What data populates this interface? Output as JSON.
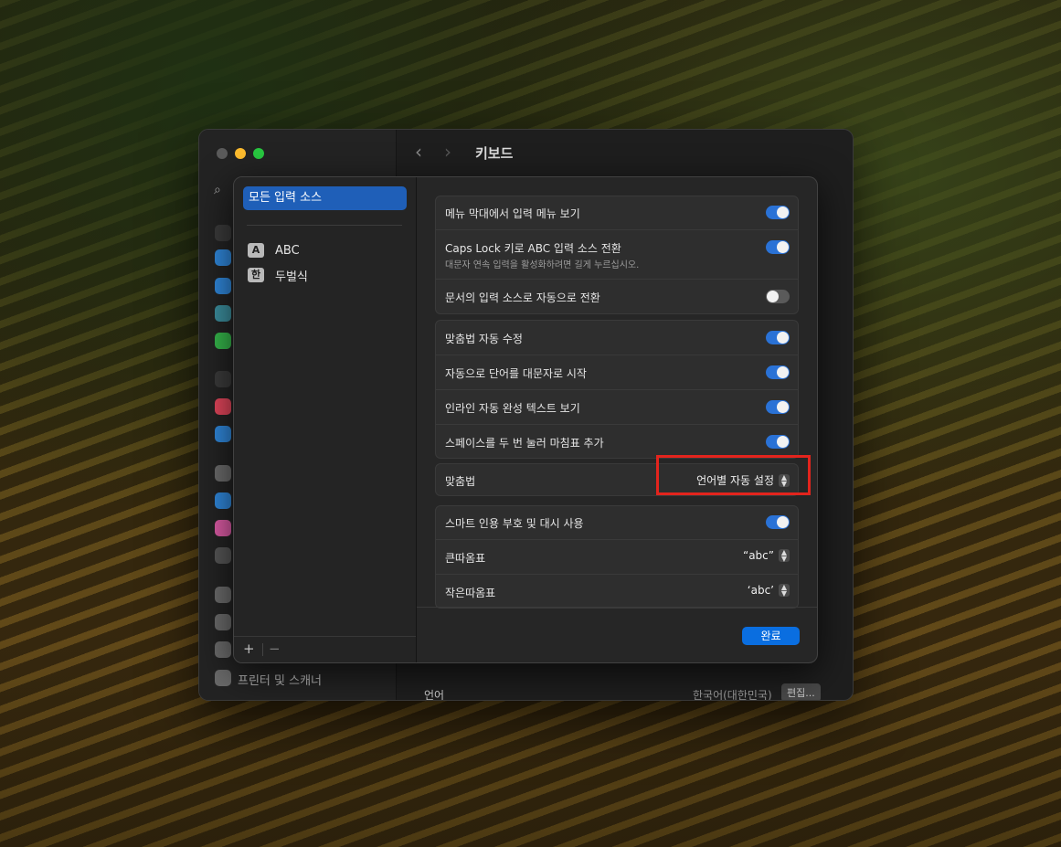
{
  "window": {
    "title": "키보드",
    "sidebar_bottom_label": "프린터 및 스캐너",
    "background_language_label": "언어",
    "background_language_value": "한국어(대한민국)",
    "background_edit_button": "편집..."
  },
  "sheet": {
    "sources": {
      "selected": "모든 입력 소스",
      "items": [
        {
          "badge": "A",
          "label": "ABC"
        },
        {
          "badge": "한",
          "label": "두벌식"
        }
      ],
      "add_label": "+",
      "remove_label": "−"
    },
    "group1": [
      {
        "label": "메뉴 막대에서 입력 메뉴 보기",
        "toggle": "on"
      },
      {
        "label": "Caps Lock 키로 ABC 입력 소스 전환",
        "sub": "대문자 연속 입력을 활성화하려면 길게 누르십시오.",
        "toggle": "on"
      },
      {
        "label": "문서의 입력 소스로 자동으로 전환",
        "toggle": "off"
      }
    ],
    "group2": [
      {
        "label": "맞춤법 자동 수정",
        "toggle": "on"
      },
      {
        "label": "자동으로 단어를 대문자로 시작",
        "toggle": "on"
      },
      {
        "label": "인라인 자동 완성 텍스트 보기",
        "toggle": "on"
      },
      {
        "label": "스페이스를 두 번 눌러 마침표 추가",
        "toggle": "on"
      }
    ],
    "spelling": {
      "label": "맞춤법",
      "value": "언어별 자동 설정"
    },
    "group4": {
      "smart_quotes_label": "스마트 인용 부호 및 대시 사용",
      "double_quotes_label": "큰따옴표",
      "double_quotes_value": "“abc”",
      "single_quotes_label": "작은따옴표",
      "single_quotes_value": "‘abc’"
    },
    "done_button": "완료"
  },
  "colors": {
    "accent": "#0a6ee0",
    "selection": "#1f5fb8",
    "highlight_box": "#e3241d"
  }
}
